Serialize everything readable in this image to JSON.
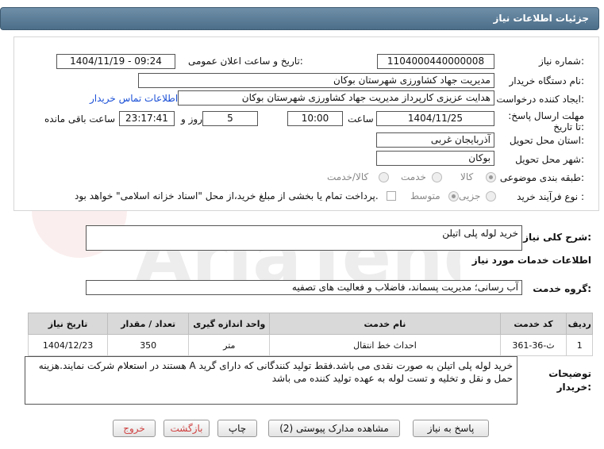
{
  "header": {
    "title": "جزئیات اطلاعات نیاز"
  },
  "form": {
    "need_number_label": "شماره نیاز:",
    "need_number": "1104000440000008",
    "announce_label": "تاریخ و ساعت اعلان عمومی:",
    "announce_value": "1404/11/19 - 09:24",
    "buyer_org_label": "نام دستگاه خریدار:",
    "buyer_org": "مدیریت جهاد کشاورزی شهرستان بوکان",
    "creator_label": "ایجاد کننده درخواست:",
    "creator": "هدایت عزیزی کارپرداز مدیریت جهاد کشاورزی شهرستان بوکان",
    "contact_link": "اطلاعات تماس خریدار",
    "deadline_label": "مهلت ارسال پاسخ: تا تاریخ:",
    "deadline_date": "1404/11/25",
    "time_label": "ساعت",
    "deadline_time": "10:00",
    "days_value": "5",
    "days_label": "روز و",
    "remaining_time": "23:17:41",
    "remaining_label": "ساعت باقی مانده",
    "province_label": "استان محل تحویل:",
    "province": "آذربایجان غربی",
    "city_label": "شهر محل تحویل:",
    "city": "بوکان",
    "category_label": "طبقه بندی موضوعی:",
    "category_options": [
      "کالا",
      "خدمت",
      "کالا/خدمت"
    ],
    "process_label": "نوع فرآیند خرید :",
    "process_options": [
      "جزیی",
      "متوسط"
    ],
    "payment_note": "پرداخت تمام یا بخشی از مبلغ خرید،از محل \"اسناد خزانه اسلامی\" خواهد بود."
  },
  "summary": {
    "label": "شرح کلی نیاز:",
    "value": "خرید لوله پلی اتیلن"
  },
  "services": {
    "section_title": "اطلاعات خدمات مورد نیاز",
    "group_label": "گروه خدمت:",
    "group_value": "آب رسانی؛ مدیریت پسماند، فاضلاب و فعالیت های تصفیه",
    "columns": [
      "ردیف",
      "کد خدمت",
      "نام خدمت",
      "واحد اندازه گیری",
      "تعداد / مقدار",
      "تاریخ نیاز"
    ],
    "rows": [
      {
        "index": "1",
        "code": "ث-36-361",
        "name": "احداث خط انتقال",
        "unit": "متر",
        "qty": "350",
        "date": "1404/12/23"
      }
    ]
  },
  "notes": {
    "label": "توضیحات خریدار:",
    "value": "خرید لوله پلی اتیلن به صورت نقدی می باشد.فقط تولید کنندگانی که دارای گرید A هستند در استعلام شرکت نمایند.هزینه حمل و نقل و تخلیه و تست لوله به عهده تولید کننده می باشد"
  },
  "buttons": {
    "reply": "پاسخ به نیاز",
    "docs": "مشاهده مدارک پیوستی (2)",
    "print": "چاپ",
    "back": "بازگشت",
    "exit": "خروج"
  },
  "colors": {
    "title_bar": "#5a7a95",
    "accent_red": "#d04040"
  }
}
